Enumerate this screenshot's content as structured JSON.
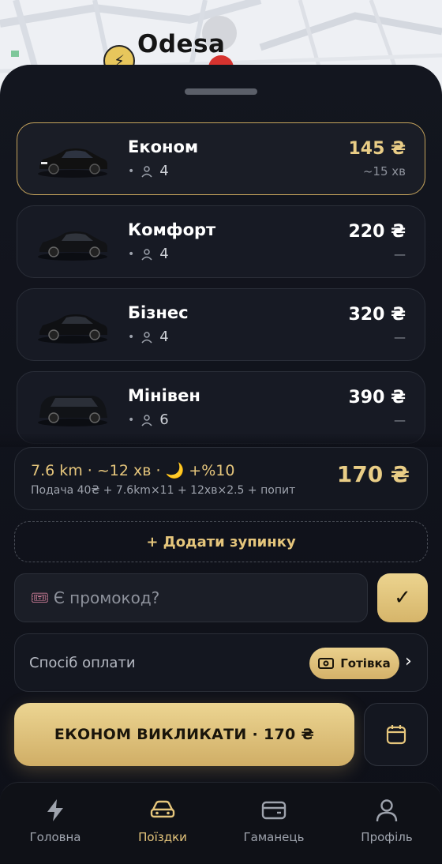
{
  "map": {
    "city": "Odesa"
  },
  "cars": [
    {
      "name": "Економ",
      "seats": "4",
      "price": "145 ₴",
      "eta": "~15 хв",
      "selected": true
    },
    {
      "name": "Комфорт",
      "seats": "4",
      "price": "220 ₴",
      "eta": "—",
      "selected": false
    },
    {
      "name": "Бізнес",
      "seats": "4",
      "price": "320 ₴",
      "eta": "—",
      "selected": false
    },
    {
      "name": "Мінівен",
      "seats": "6",
      "price": "390 ₴",
      "eta": "—",
      "selected": false
    }
  ],
  "fare": {
    "summary": "7.6 km · ~12 хв · 🌙 +%10",
    "breakdown": "Подача 40₴ + 7.6km×11 + 12хв×2.5 + попит",
    "total": "170 ₴"
  },
  "add_stop": "+ Додати зупинку",
  "promo": {
    "placeholder": "Є промокод?",
    "icon": "ticket-icon",
    "confirm": "✓"
  },
  "payment": {
    "label": "Спосіб оплати",
    "method": "Готівка",
    "method_icon": "cash-icon"
  },
  "cta": {
    "label": "ЕКОНОМ ВИКЛИКАТИ · 170 ₴"
  },
  "schedule_icon": "calendar-icon",
  "nav": [
    {
      "label": "Головна",
      "icon": "bolt-icon"
    },
    {
      "label": "Поїздки",
      "icon": "car-icon",
      "active": true
    },
    {
      "label": "Гаманець",
      "icon": "wallet-icon"
    },
    {
      "label": "Профіль",
      "icon": "user-icon"
    }
  ],
  "colors": {
    "accent": "#e6c67c",
    "background": "#0e1018",
    "card": "#171a24",
    "selected_border": "#c6a45c"
  }
}
